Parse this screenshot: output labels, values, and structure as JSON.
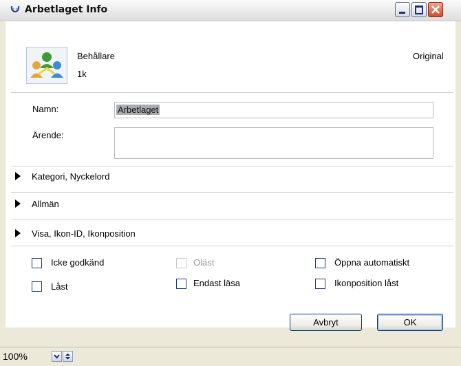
{
  "window": {
    "title": "Arbetlaget Info"
  },
  "header": {
    "kind": "Behållare",
    "size": "1k",
    "status": "Original",
    "icon": "group-people-icon"
  },
  "fields": {
    "name_label": "Namn:",
    "name_value": "Arbetlaget",
    "subject_label": "Ärende:",
    "subject_value": ""
  },
  "sections": [
    {
      "label": "Kategori, Nyckelord"
    },
    {
      "label": "Allmän"
    },
    {
      "label": "Visa, Ikon-ID, Ikonposition"
    }
  ],
  "checkboxes": [
    {
      "label": "Icke godkänd",
      "checked": false,
      "enabled": true
    },
    {
      "label": "Oläst",
      "checked": false,
      "enabled": false
    },
    {
      "label": "Öppna automatiskt",
      "checked": false,
      "enabled": true
    },
    {
      "label": "Låst",
      "checked": false,
      "enabled": true
    },
    {
      "label": "Endast läsa",
      "checked": false,
      "enabled": true
    },
    {
      "label": "Ikonposition låst",
      "checked": false,
      "enabled": true
    }
  ],
  "buttons": {
    "cancel": "Avbryt",
    "ok": "OK"
  },
  "statusbar": {
    "zoom": "100%"
  },
  "colors": {
    "title_bar": "#e9e9e9",
    "close_button": "#d64b2a",
    "dialog_bg": "#ffffff",
    "frame": "#ece9d8"
  }
}
